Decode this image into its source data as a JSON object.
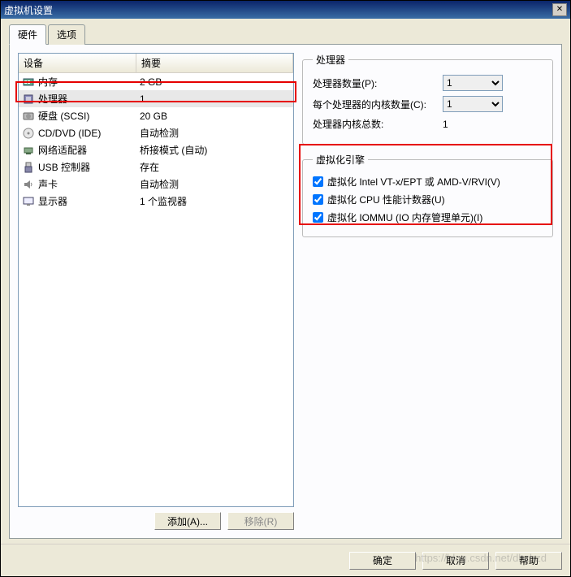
{
  "window": {
    "title": "虚拟机设置"
  },
  "tabs": {
    "hardware": "硬件",
    "options": "选项"
  },
  "headers": {
    "device": "设备",
    "summary": "摘要"
  },
  "devices": [
    {
      "icon": "memory",
      "name": "内存",
      "summary": "2 GB"
    },
    {
      "icon": "cpu",
      "name": "处理器",
      "summary": "1"
    },
    {
      "icon": "hdd",
      "name": "硬盘 (SCSI)",
      "summary": "20 GB"
    },
    {
      "icon": "cd",
      "name": "CD/DVD (IDE)",
      "summary": "自动检测"
    },
    {
      "icon": "net",
      "name": "网络适配器",
      "summary": "桥接模式 (自动)"
    },
    {
      "icon": "usb",
      "name": "USB 控制器",
      "summary": "存在"
    },
    {
      "icon": "sound",
      "name": "声卡",
      "summary": "自动检测"
    },
    {
      "icon": "display",
      "name": "显示器",
      "summary": "1 个监视器"
    }
  ],
  "buttons": {
    "add": "添加(A)...",
    "remove": "移除(R)",
    "ok": "确定",
    "cancel": "取消",
    "help": "帮助"
  },
  "processor_panel": {
    "legend": "处理器",
    "num_processors_label": "处理器数量(P):",
    "num_processors_value": "1",
    "cores_per_label": "每个处理器的内核数量(C):",
    "cores_per_value": "1",
    "total_label": "处理器内核总数:",
    "total_value": "1"
  },
  "virt_engine": {
    "legend": "虚拟化引擎",
    "vt_x": "虚拟化 Intel VT-x/EPT 或 AMD-V/RVI(V)",
    "cpu_perf": "虚拟化 CPU 性能计数器(U)",
    "iommu": "虚拟化 IOMMU (IO 内存管理单元)(I)"
  },
  "watermark": "https://blog.csdn.net/dhzhzd"
}
